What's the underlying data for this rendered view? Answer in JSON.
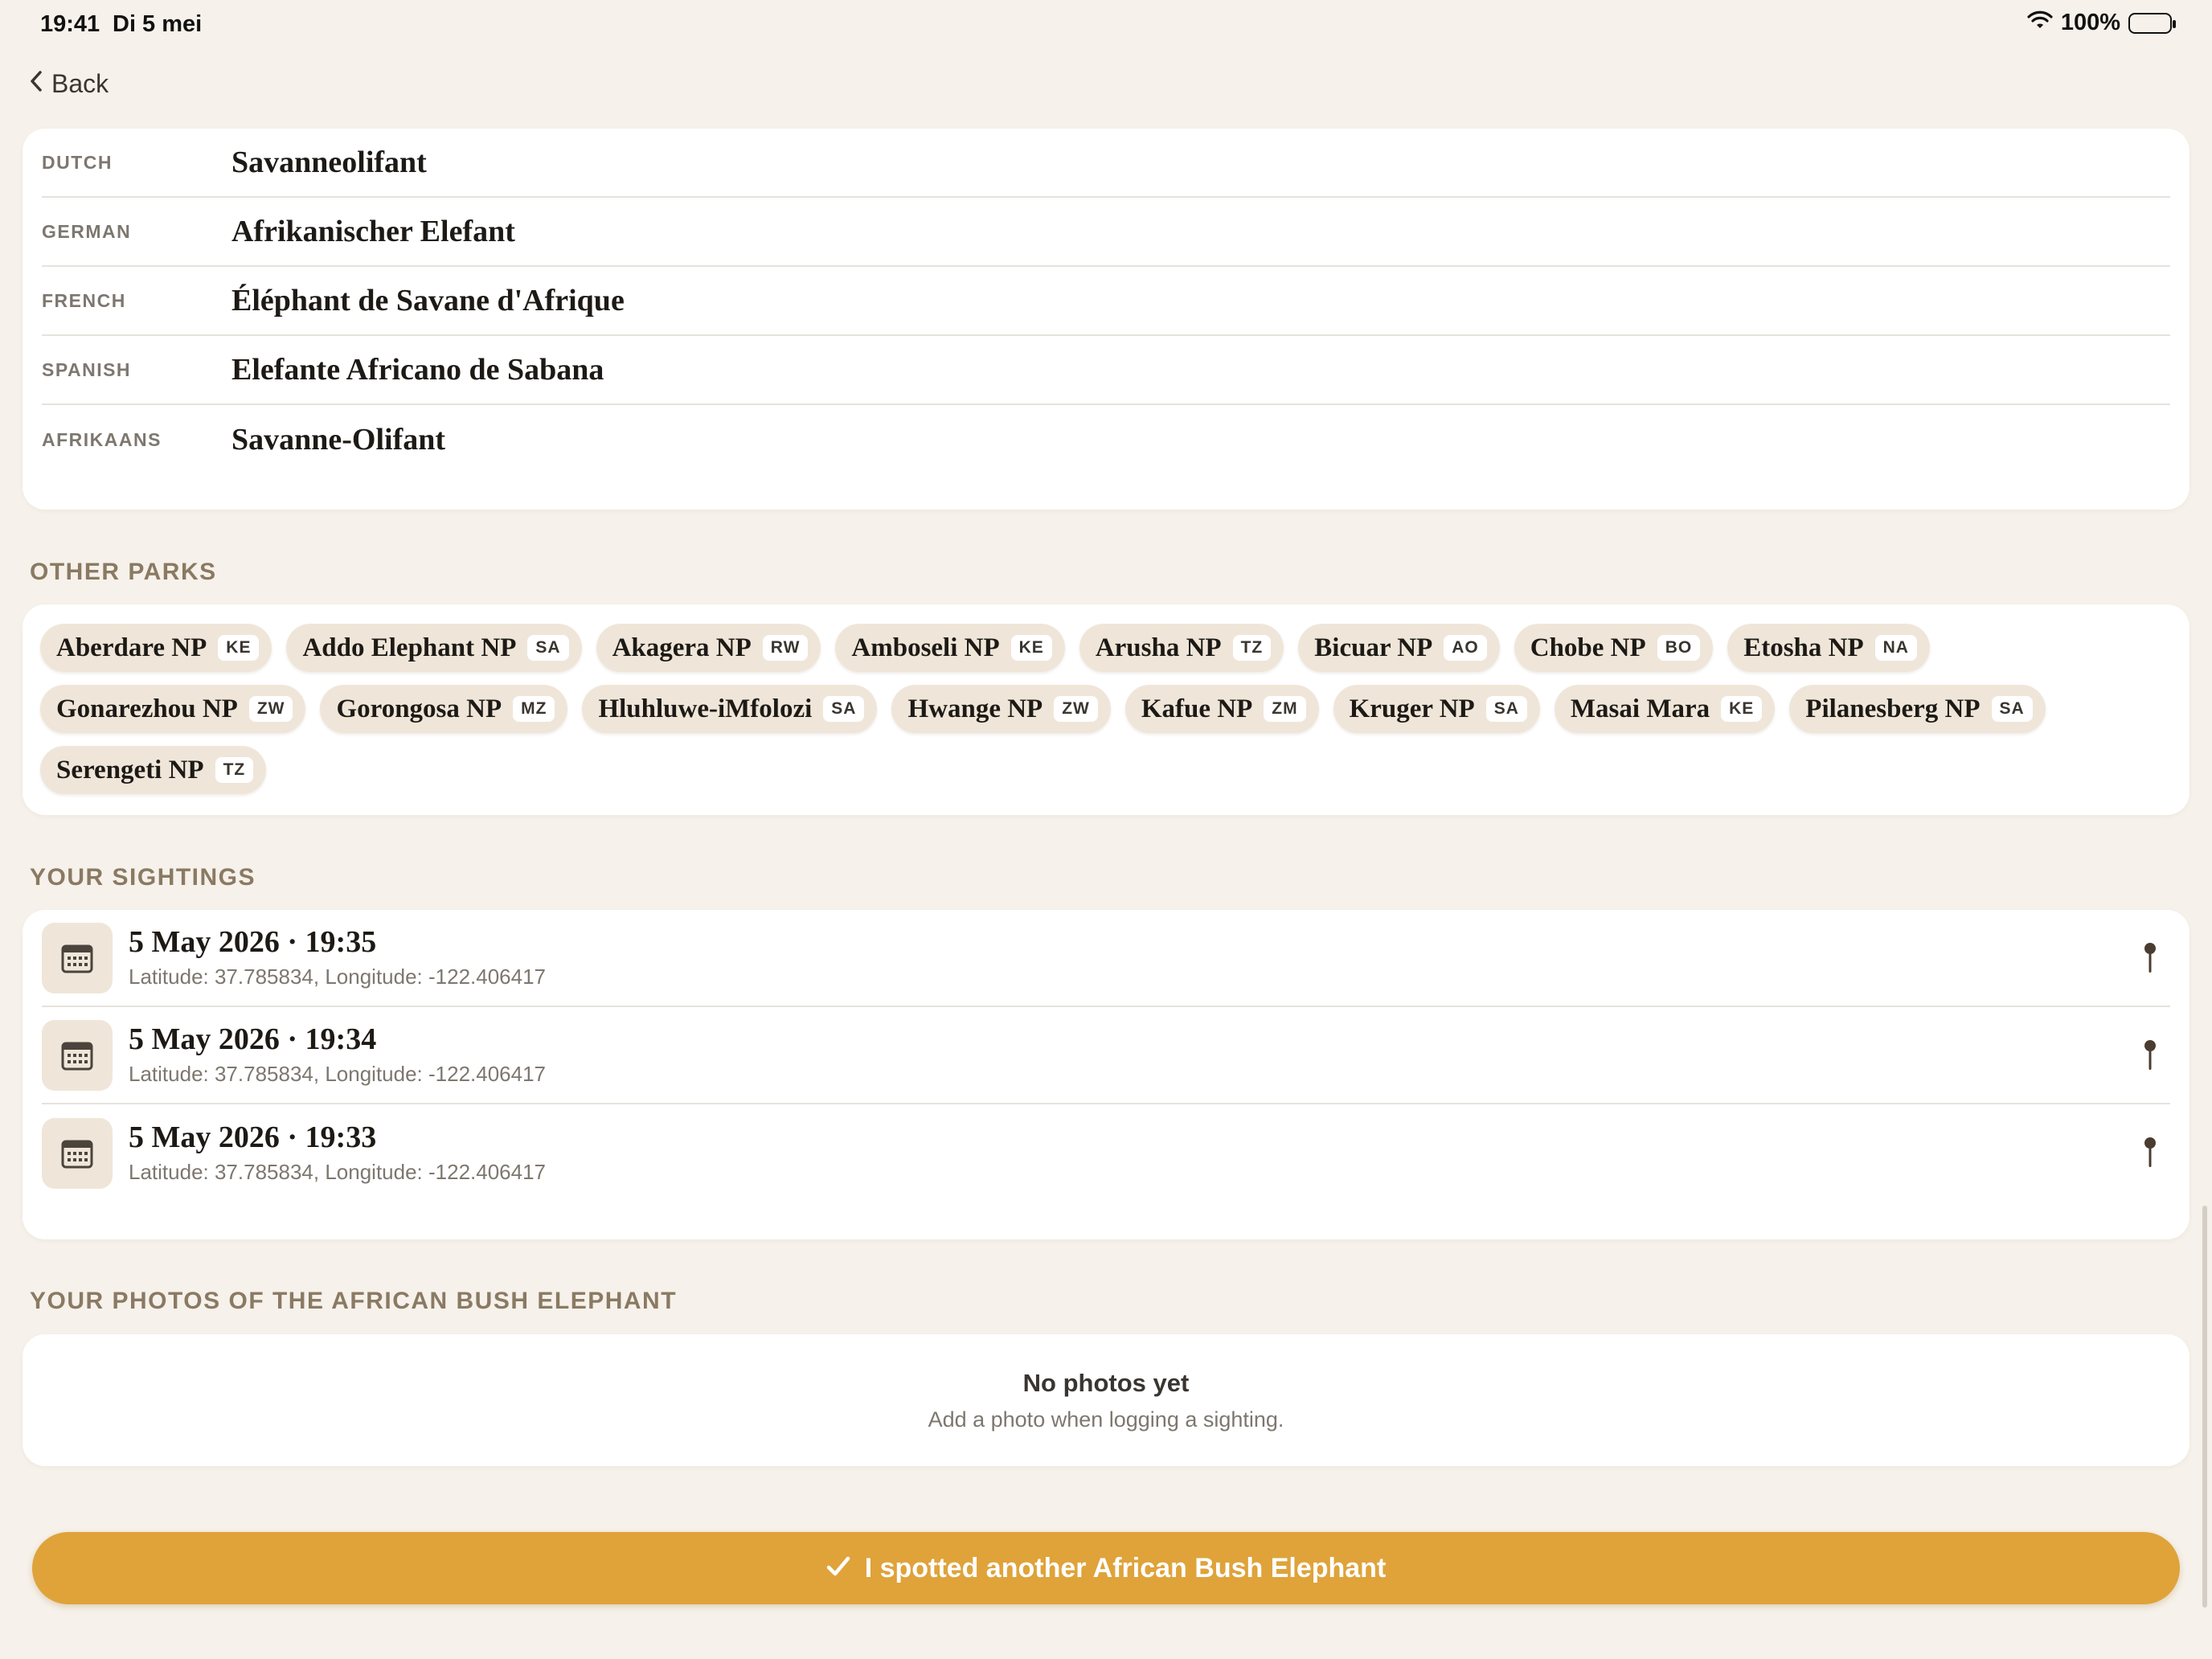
{
  "status_bar": {
    "time": "19:41",
    "date": "Di 5 mei",
    "battery": "100%"
  },
  "nav": {
    "back_label": "Back"
  },
  "names": [
    {
      "lang": "DUTCH",
      "name": "Savanneolifant"
    },
    {
      "lang": "GERMAN",
      "name": "Afrikanischer Elefant"
    },
    {
      "lang": "FRENCH",
      "name": "Éléphant de Savane d'Afrique"
    },
    {
      "lang": "SPANISH",
      "name": "Elefante Africano de Sabana"
    },
    {
      "lang": "AFRIKAANS",
      "name": "Savanne-Olifant"
    }
  ],
  "other_parks": {
    "title": "OTHER PARKS",
    "parks": [
      {
        "name": "Aberdare NP",
        "code": "KE"
      },
      {
        "name": "Addo Elephant NP",
        "code": "SA"
      },
      {
        "name": "Akagera NP",
        "code": "RW"
      },
      {
        "name": "Amboseli NP",
        "code": "KE"
      },
      {
        "name": "Arusha NP",
        "code": "TZ"
      },
      {
        "name": "Bicuar NP",
        "code": "AO"
      },
      {
        "name": "Chobe NP",
        "code": "BO"
      },
      {
        "name": "Etosha NP",
        "code": "NA"
      },
      {
        "name": "Gonarezhou NP",
        "code": "ZW"
      },
      {
        "name": "Gorongosa NP",
        "code": "MZ"
      },
      {
        "name": "Hluhluwe-iMfolozi",
        "code": "SA"
      },
      {
        "name": "Hwange NP",
        "code": "ZW"
      },
      {
        "name": "Kafue NP",
        "code": "ZM"
      },
      {
        "name": "Kruger NP",
        "code": "SA"
      },
      {
        "name": "Masai Mara",
        "code": "KE"
      },
      {
        "name": "Pilanesberg NP",
        "code": "SA"
      },
      {
        "name": "Serengeti NP",
        "code": "TZ"
      }
    ]
  },
  "sightings": {
    "title": "YOUR SIGHTINGS",
    "items": [
      {
        "date": "5 May 2026 · 19:35",
        "coords": "Latitude: 37.785834, Longitude: -122.406417"
      },
      {
        "date": "5 May 2026 · 19:34",
        "coords": "Latitude: 37.785834, Longitude: -122.406417"
      },
      {
        "date": "5 May 2026 · 19:33",
        "coords": "Latitude: 37.785834, Longitude: -122.406417"
      }
    ]
  },
  "photos": {
    "title": "YOUR PHOTOS OF THE AFRICAN BUSH ELEPHANT",
    "empty_title": "No photos yet",
    "empty_subtitle": "Add a photo when logging a sighting."
  },
  "cta": {
    "label": "I spotted another African Bush Elephant"
  },
  "colors": {
    "background": "#f6f1ea",
    "accent": "#dfa33a",
    "chip_bg": "#efe6d9",
    "section_title": "#8a7a63"
  }
}
